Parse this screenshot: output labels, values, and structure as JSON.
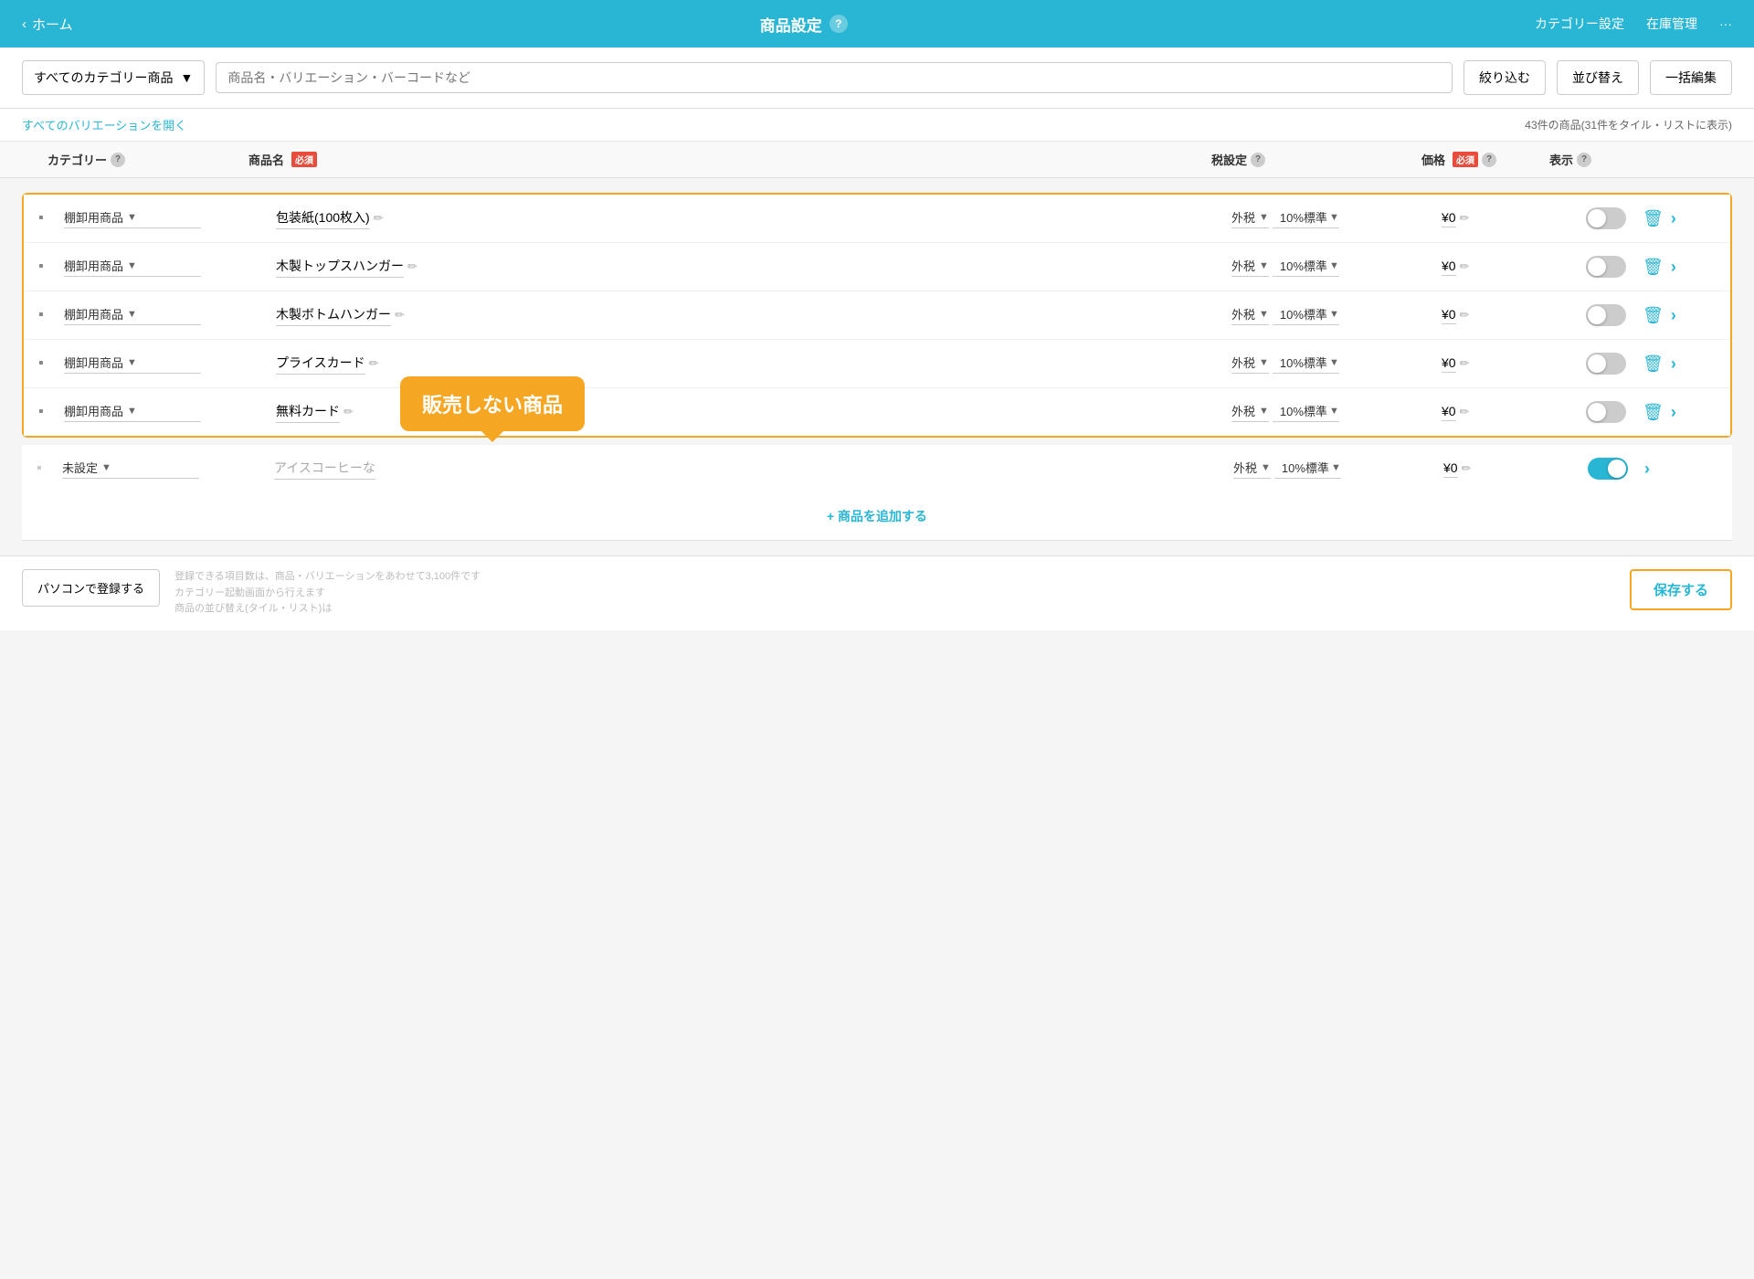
{
  "header": {
    "back_label": "ホーム",
    "title": "商品設定",
    "help_icon": "?",
    "nav_items": [
      "カテゴリー設定",
      "在庫管理",
      "···"
    ]
  },
  "toolbar": {
    "category_select": "すべてのカテゴリー商品",
    "search_placeholder": "商品名・バリエーション・バーコードなど",
    "filter_label": "絞り込む",
    "sort_label": "並び替え",
    "bulk_edit_label": "一括編集"
  },
  "sub_toolbar": {
    "expand_all": "すべてのバリエーションを開く",
    "count_text": "43件の商品(31件をタイル・リストに表示)"
  },
  "table_header": {
    "category": "カテゴリー",
    "product_name": "商品名",
    "required_badge": "必須",
    "tax_setting": "税設定",
    "price": "価格",
    "display": "表示"
  },
  "orange_group_products": [
    {
      "id": 1,
      "category": "棚卸用商品",
      "product_name": "包装紙(100枚入)",
      "tax_type": "外税",
      "tax_rate": "10%標準",
      "price": "¥0",
      "toggle_on": false
    },
    {
      "id": 2,
      "category": "棚卸用商品",
      "product_name": "木製トップスハンガー",
      "tax_type": "外税",
      "tax_rate": "10%標準",
      "price": "¥0",
      "toggle_on": false
    },
    {
      "id": 3,
      "category": "棚卸用商品",
      "product_name": "木製ボトムハンガー",
      "tax_type": "外税",
      "tax_rate": "10%標準",
      "price": "¥0",
      "toggle_on": false
    },
    {
      "id": 4,
      "category": "棚卸用商品",
      "product_name": "プライスカード",
      "tax_type": "外税",
      "tax_rate": "10%標準",
      "price": "¥0",
      "toggle_on": false
    },
    {
      "id": 5,
      "category": "棚卸用商品",
      "product_name": "無料カード",
      "tax_type": "外税",
      "tax_rate": "10%標準",
      "price": "¥0",
      "toggle_on": false
    }
  ],
  "unsettled_product": {
    "category": "未設定",
    "product_name": "アイスコーヒーな",
    "tax_type": "外税",
    "tax_rate": "10%標準",
    "price": "¥0",
    "toggle_on": true
  },
  "callout": {
    "text": "販売しない商品"
  },
  "add_product": {
    "label": "+ 商品を追加する"
  },
  "footer": {
    "register_label": "パソコンで登録する",
    "notes": [
      "登録できる項目数は、商品・バリエーションをあわせて3,100件です",
      "カテゴリー起動画面から行えます",
      "商品の並び替え(タイル・リスト)は"
    ],
    "save_label": "保存する"
  }
}
